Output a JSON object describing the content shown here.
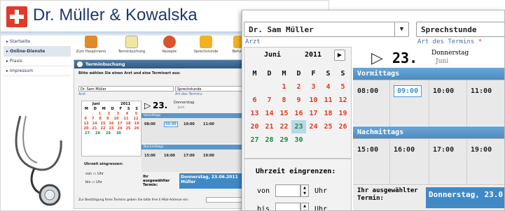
{
  "site": {
    "title": "Dr. Müller & Kowalska"
  },
  "sidebar": {
    "items": [
      {
        "label": "Startseite"
      },
      {
        "label": "Online-Dienste"
      },
      {
        "label": "Praxis"
      },
      {
        "label": "Impressum"
      }
    ]
  },
  "topnav": {
    "items": [
      {
        "label": "Zum Hauptmenü",
        "icon": "house-icon"
      },
      {
        "label": "Terminbuchung",
        "icon": "calendar-icon"
      },
      {
        "label": "Rezepte",
        "icon": "pills-icon"
      },
      {
        "label": "Sprechstunde",
        "icon": "folder-icon"
      },
      {
        "label": "Befunde",
        "icon": "folder-icon"
      }
    ]
  },
  "panel": {
    "title": "Terminbuchung",
    "instruction": "Bitte wählen Sie einen Arzt und eine Terminart aus:",
    "doctor": "Dr. Sam Müller",
    "doctor_label": "Arzt",
    "type": "Sprechstunde",
    "type_label": "Art des Termins",
    "confirm_text": "Zur Bestätigung Ihres Termins geben Sie bitte Ihre E-Mail-Adresse ein:"
  },
  "selectors": {
    "doctor": "Dr. Sam Müller",
    "doctor_label": "Arzt",
    "type": "Sprechstunde",
    "type_label": "Art des Termins",
    "required_mark": "*"
  },
  "calendar": {
    "month": "Juni",
    "year": "2011",
    "next": "▶",
    "weekdays": [
      "M",
      "D",
      "M",
      "D",
      "F",
      "S",
      "S"
    ],
    "weeks": [
      [
        "",
        "",
        "1",
        "2",
        "3",
        "4",
        "5"
      ],
      [
        "6",
        "7",
        "8",
        "9",
        "10",
        "11",
        "12"
      ],
      [
        "13",
        "14",
        "15",
        "16",
        "17",
        "18",
        "19"
      ],
      [
        "20",
        "21",
        "22",
        "23",
        "24",
        "25",
        "26"
      ],
      [
        "27",
        "28",
        "29",
        "30",
        "",
        "",
        ""
      ]
    ],
    "selected": "23"
  },
  "range": {
    "title": "Uhrzeit eingrenzen:",
    "from_label": "von",
    "to_label": "bis",
    "unit": "Uhr"
  },
  "day": {
    "number": "23.",
    "weekday": "Donnerstag",
    "month": "Juni"
  },
  "morning": {
    "label": "Vormittags",
    "times": [
      "08:00",
      "09:00",
      "10:00",
      "11:00"
    ],
    "selected": "09:00"
  },
  "afternoon": {
    "label": "Nachmittags",
    "times": [
      "15:00",
      "16:00",
      "17:00",
      "19:00"
    ]
  },
  "summary": {
    "label": "Ihr ausgewählter Termin:",
    "value": "Donnerstag, 23.06.2011",
    "value2": "Müller",
    "value_front": "Donnerstag, 23.0"
  }
}
